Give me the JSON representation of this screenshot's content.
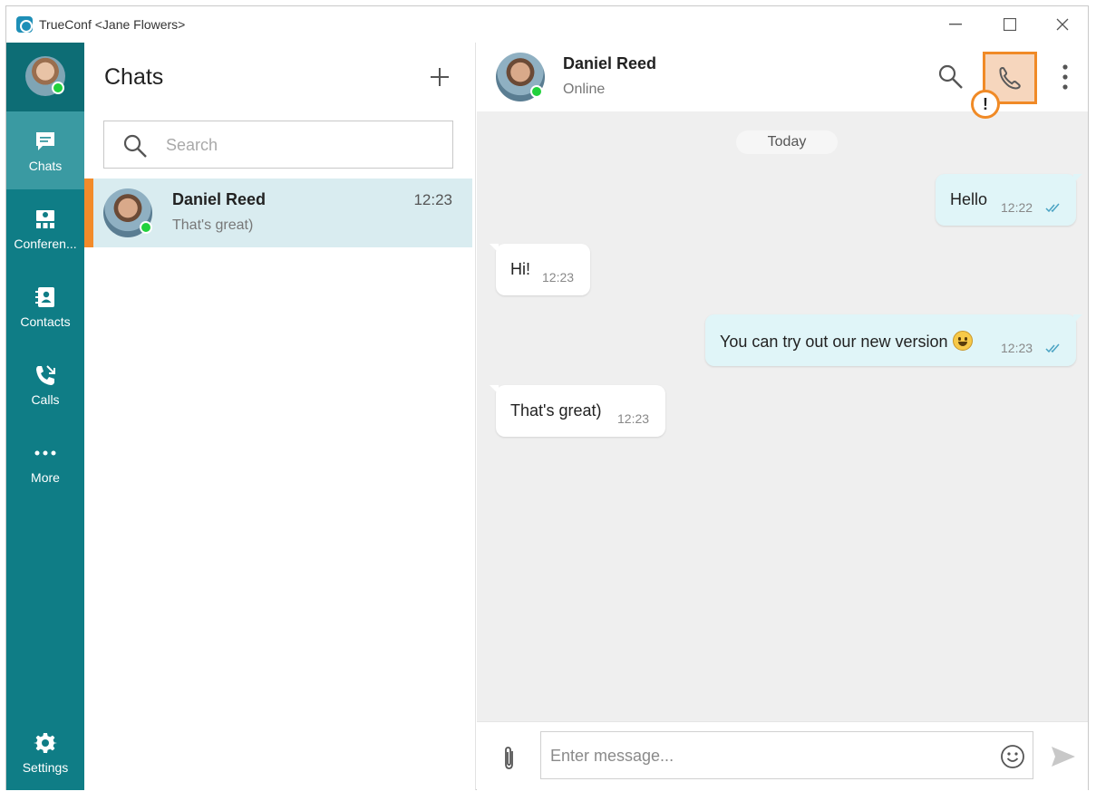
{
  "window": {
    "title": "TrueConf <Jane Flowers>",
    "controls": [
      "minimize",
      "maximize",
      "close"
    ]
  },
  "nav": {
    "items": [
      {
        "label": "Chats",
        "icon": "chat-icon",
        "active": true
      },
      {
        "label": "Conferen...",
        "icon": "conference-icon",
        "active": false
      },
      {
        "label": "Contacts",
        "icon": "contacts-icon",
        "active": false
      },
      {
        "label": "Calls",
        "icon": "calls-icon",
        "active": false
      },
      {
        "label": "More",
        "icon": "more-dots-icon",
        "active": false
      }
    ],
    "settings_label": "Settings"
  },
  "chat_list": {
    "title": "Chats",
    "search_placeholder": "Search",
    "chats": [
      {
        "name": "Daniel Reed",
        "time": "12:23",
        "preview": "That's great)",
        "online": true,
        "selected": true
      }
    ]
  },
  "conversation": {
    "contact_name": "Daniel Reed",
    "status": "Online",
    "call_warning": "!",
    "day_separator": "Today",
    "messages": [
      {
        "direction": "out",
        "text": "Hello",
        "time": "12:22",
        "read": true
      },
      {
        "direction": "in",
        "text": "Hi!",
        "time": "12:23"
      },
      {
        "direction": "out",
        "text": "You can try out our new version",
        "time": "12:23",
        "read": true,
        "emoji": "grinning-face"
      },
      {
        "direction": "in",
        "text": "That's great)",
        "time": "12:23"
      }
    ],
    "input_placeholder": "Enter message..."
  },
  "colors": {
    "rail": "#0f7d86",
    "rail_active": "#3a9aa2",
    "selected_row": "#d9ecf0",
    "accent_orange": "#f08a26",
    "outgoing_bubble": "#e0f5f8",
    "online": "#21d13c"
  }
}
